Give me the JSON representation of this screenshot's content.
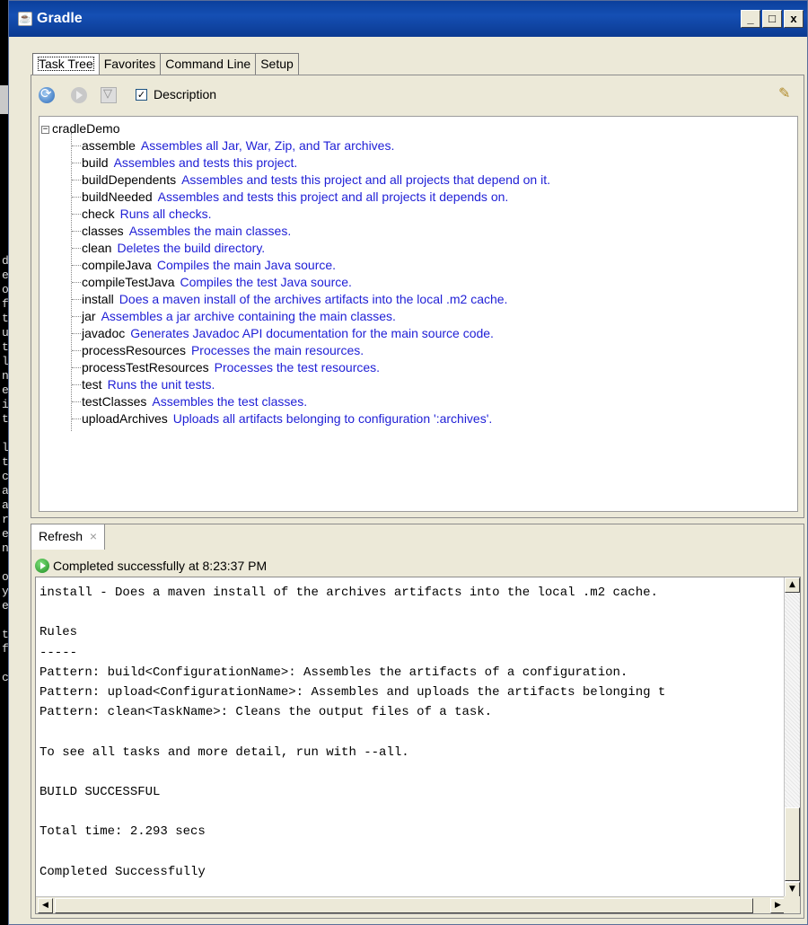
{
  "window": {
    "title": "Gradle",
    "minimize": "_",
    "maximize": "□",
    "close": "x"
  },
  "tabs": [
    {
      "label": "Task Tree",
      "active": true
    },
    {
      "label": "Favorites",
      "active": false
    },
    {
      "label": "Command Line",
      "active": false
    },
    {
      "label": "Setup",
      "active": false
    }
  ],
  "toolbar": {
    "icons": [
      "refresh-icon",
      "run-icon",
      "filter-icon",
      "wand-icon"
    ],
    "description_checkbox": {
      "label": "Description",
      "checked": true
    }
  },
  "tree": {
    "root": "cradleDemo",
    "tasks": [
      {
        "name": "assemble",
        "desc": "Assembles all Jar, War, Zip, and Tar archives."
      },
      {
        "name": "build",
        "desc": "Assembles and tests this project."
      },
      {
        "name": "buildDependents",
        "desc": "Assembles and tests this project and all projects that depend on it."
      },
      {
        "name": "buildNeeded",
        "desc": "Assembles and tests this project and all projects it depends on."
      },
      {
        "name": "check",
        "desc": "Runs all checks."
      },
      {
        "name": "classes",
        "desc": "Assembles the main classes."
      },
      {
        "name": "clean",
        "desc": "Deletes the build directory."
      },
      {
        "name": "compileJava",
        "desc": "Compiles the main Java source."
      },
      {
        "name": "compileTestJava",
        "desc": "Compiles the test Java source."
      },
      {
        "name": "install",
        "desc": "Does a maven install of the archives artifacts into the local .m2 cache."
      },
      {
        "name": "jar",
        "desc": "Assembles a jar archive containing the main classes."
      },
      {
        "name": "javadoc",
        "desc": "Generates Javadoc API documentation for the main source code."
      },
      {
        "name": "processResources",
        "desc": "Processes the main resources."
      },
      {
        "name": "processTestResources",
        "desc": "Processes the test resources."
      },
      {
        "name": "test",
        "desc": "Runs the unit tests."
      },
      {
        "name": "testClasses",
        "desc": "Assembles the test classes."
      },
      {
        "name": "uploadArchives",
        "desc": "Uploads all artifacts belonging to configuration ':archives'."
      }
    ]
  },
  "output": {
    "tab_label": "Refresh",
    "tab_close": "×",
    "status": "Completed successfully at 8:23:37 PM",
    "console_lines": [
      "install - Does a maven install of the archives artifacts into the local .m2 cache.",
      "",
      "Rules",
      "-----",
      "Pattern: build<ConfigurationName>: Assembles the artifacts of a configuration.",
      "Pattern: upload<ConfigurationName>: Assembles and uploads the artifacts belonging t",
      "Pattern: clean<TaskName>: Cleans the output files of a task.",
      "",
      "To see all tasks and more detail, run with --all.",
      "",
      "BUILD SUCCESSFUL",
      "",
      "Total time: 2.293 secs",
      "",
      "Completed Successfully"
    ]
  },
  "background_terminal": {
    "fragments": [
      "d",
      "e",
      "o",
      "f",
      "t",
      "u",
      "t",
      "l",
      "n",
      "e",
      "i",
      "t",
      "",
      "l",
      "t",
      "c",
      "a",
      "a",
      "r",
      "e",
      "n",
      "",
      "o",
      "y",
      "e",
      "",
      "t",
      "f",
      "",
      "c"
    ]
  }
}
